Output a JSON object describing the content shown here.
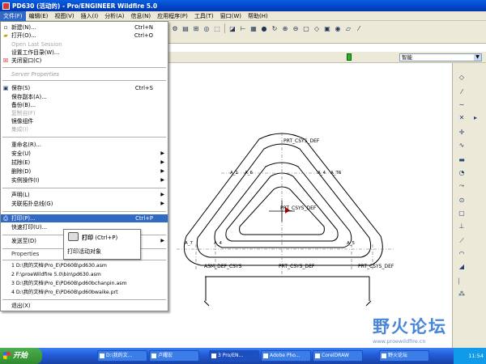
{
  "window": {
    "title": "PD630 (活动的) - Pro/ENGINEER Wildfire 5.0"
  },
  "menubar": [
    "文件(F)",
    "编辑(E)",
    "视图(V)",
    "插入(I)",
    "分析(A)",
    "信息(N)",
    "应用程序(P)",
    "工具(T)",
    "窗口(W)",
    "帮助(H)"
  ],
  "filemenu": {
    "items": [
      {
        "label": "新建(N)...",
        "shortcut": "Ctrl+N",
        "icon": "new-icon"
      },
      {
        "label": "打开(O)...",
        "shortcut": "Ctrl+O",
        "icon": "open-icon"
      },
      {
        "label": "Open Last Session",
        "state": "disabled"
      },
      {
        "label": "设置工作目录(W)..."
      },
      {
        "label": "关闭窗口(C)",
        "icon": "close-window-icon"
      },
      {
        "label": "Server Properties",
        "state": "header"
      },
      {
        "label": "保存(S)",
        "shortcut": "Ctrl+S",
        "icon": "save-icon"
      },
      {
        "label": "保存副本(A)..."
      },
      {
        "label": "备份(B)..."
      },
      {
        "label": "复制自(F)",
        "state": "disabled"
      },
      {
        "label": "镜像组件"
      },
      {
        "label": "集成(I)",
        "state": "disabled"
      },
      {
        "label": "重命名(R)..."
      },
      {
        "label": "安全(U)"
      },
      {
        "label": "拭除(E)"
      },
      {
        "label": "删除(D)"
      },
      {
        "label": "实例操作(I)"
      },
      {
        "label": "声明(L)"
      },
      {
        "label": "关联拓扑总线(G)"
      },
      {
        "label": "打印(P)...",
        "shortcut": "Ctrl+P",
        "icon": "print-icon",
        "state": "selected"
      },
      {
        "label": "快速打印(U)..."
      },
      {
        "label": "发送至(D)"
      },
      {
        "label": "Properties",
        "state": "header"
      },
      {
        "label": "1 D:\\我的文档\\Pro_E\\PD60B\\pd630.asm"
      },
      {
        "label": "2 F:\\proeWildfire 5.0\\bin\\pd630.asm"
      },
      {
        "label": "3 D:\\我的文档\\Pro_E\\PD60B\\pd60bchanpin.asm"
      },
      {
        "label": "4 D:\\我的文档\\Pro_E\\PD60B\\pd60bwaike.prt"
      },
      {
        "label": "退出(X)"
      }
    ]
  },
  "tooltip": {
    "title": "打印",
    "shortcut": "(Ctrl+P)",
    "description": "打印活动对象"
  },
  "filter": {
    "selected": "智能"
  },
  "drawing": {
    "labels": {
      "top": "PRT_CSYS_DEF",
      "center": "PRT_CSYS_DEF",
      "bottom_left": "ASM_DEF_CSYS",
      "bottom_mid": "PRT_CSYS_DEF",
      "bottom_right": "PRT_CSYS_DEF",
      "a1": "A_1",
      "a2": "A_6",
      "a3": "A_4",
      "a4": "A_3",
      "a5": "A_8",
      "a6": "A_T6",
      "a7": "A_7",
      "a8": "A_4",
      "a9": "A_5"
    }
  },
  "taskbar": {
    "start": "开始",
    "tasks": [
      "D:\\我的文...",
      "卢耀宏",
      "3 Pro/EN...",
      "Adobe Pho...",
      "CorelDRAW",
      "野火论坛"
    ],
    "time": "11:54"
  },
  "watermark": {
    "title": "野火论坛",
    "url": "www.proewildfire.cn"
  },
  "colors": {
    "accent": "#316ac5",
    "titlebar": "#0a5ee0"
  }
}
